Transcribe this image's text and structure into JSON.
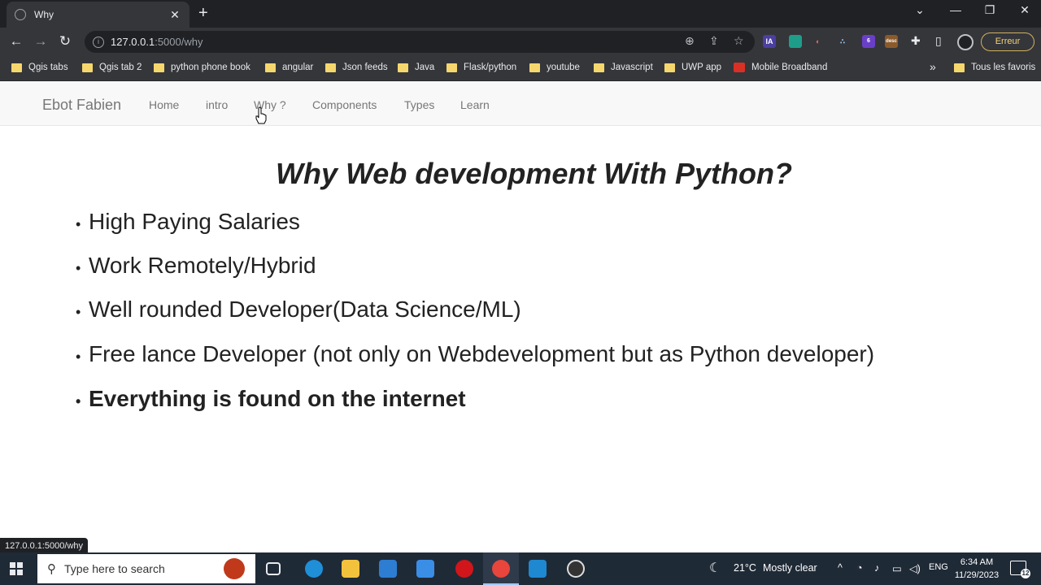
{
  "browser": {
    "tab_title": "Why",
    "url_host": "127.0.0.1",
    "url_path": ":5000/why",
    "profile_button": "Erreur",
    "extension_badge_count": "6",
    "extension_badge_desc": "desc",
    "extension_ia_label": "IA",
    "status_url": "127.0.0.1:5000/why",
    "bookmarks": [
      {
        "label": "Qgis tabs",
        "icon": "folder"
      },
      {
        "label": "Qgis tab 2",
        "icon": "folder"
      },
      {
        "label": "python phone book",
        "icon": "folder"
      },
      {
        "label": "angular",
        "icon": "folder"
      },
      {
        "label": "Json feeds",
        "icon": "folder"
      },
      {
        "label": "Java",
        "icon": "folder"
      },
      {
        "label": "Flask/python",
        "icon": "folder"
      },
      {
        "label": "youtube",
        "icon": "folder"
      },
      {
        "label": "Javascript",
        "icon": "folder"
      },
      {
        "label": "UWP app",
        "icon": "folder"
      },
      {
        "label": "Mobile Broadband",
        "icon": "huawei-logo"
      }
    ],
    "bookmarks_overflow": "»",
    "all_bookmarks": "Tous les favoris"
  },
  "site": {
    "brand": "Ebot Fabien",
    "nav": [
      "Home",
      "intro",
      "Why ?",
      "Components",
      "Types",
      "Learn"
    ],
    "heading": "Why Web development With Python?",
    "items": [
      "High Paying Salaries",
      "Work Remotely/Hybrid",
      "Well rounded Developer(Data Science/ML)",
      "Free lance Developer (not only on Webdevelopment but as Python developer)",
      "Everything is found on the internet"
    ]
  },
  "taskbar": {
    "search_placeholder": "Type here to search",
    "weather_temp": "21°C",
    "weather_desc": "Mostly clear",
    "language": "ENG",
    "time": "6:34 AM",
    "date": "11/29/2023",
    "notification_count": "12"
  },
  "colors": {
    "chrome_dark": "#202124",
    "chrome_toolbar": "#35363a",
    "navbar_bg": "#f8f8f8",
    "taskbar_bg": "#1f2a37"
  }
}
